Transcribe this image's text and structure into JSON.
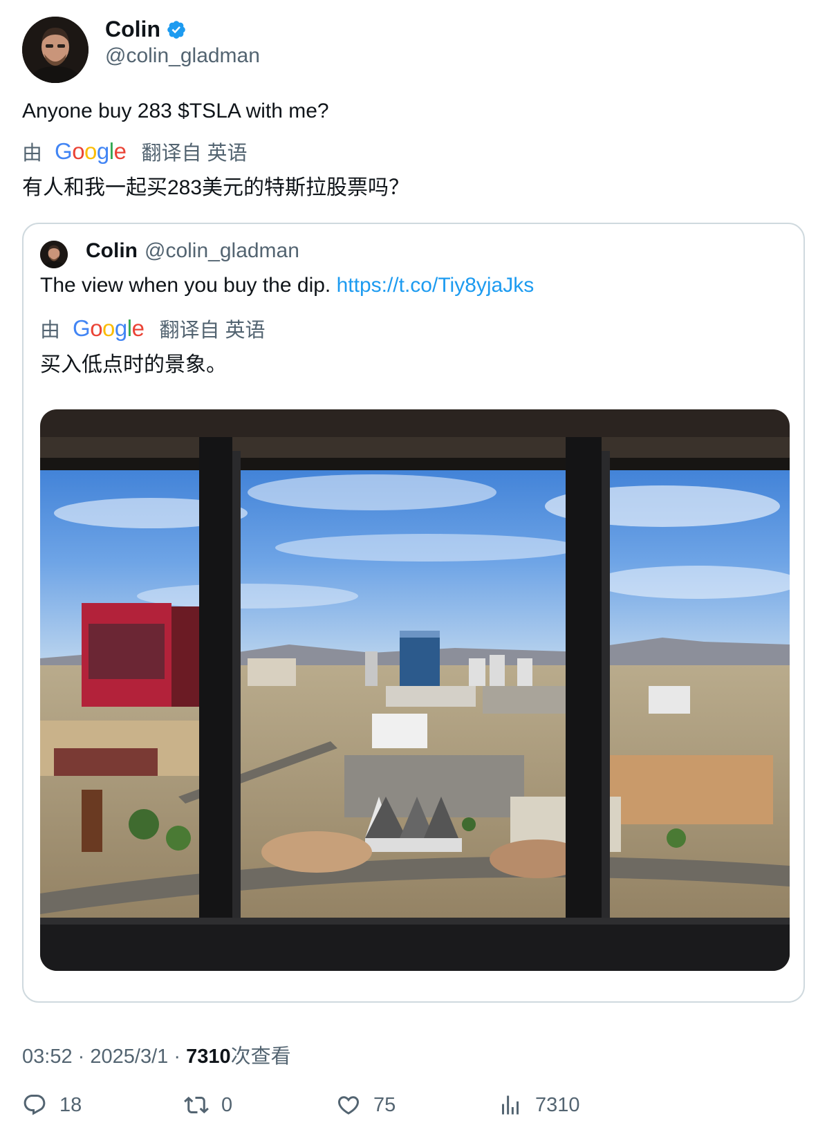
{
  "author": {
    "name": "Colin",
    "handle": "@colin_gladman",
    "verified": true
  },
  "tweet": {
    "text": "Anyone buy 283 $TSLA with me?",
    "translation_prefix": "由",
    "translation_provider": "Google",
    "translation_suffix": "翻译自 英语",
    "translation_text": "有人和我一起买283美元的特斯拉股票吗？"
  },
  "quote": {
    "name": "Colin",
    "handle": "@colin_gladman",
    "text": "The view when you buy the dip.",
    "link": "https://t.co/Tiy8yjaJks",
    "translation_prefix": "由",
    "translation_provider": "Google",
    "translation_suffix": "翻译自 英语",
    "translation_text": "买入低点时的景象。"
  },
  "meta": {
    "time": "03:52",
    "date": "2025/3/1",
    "views": "7310",
    "views_label": "次查看",
    "separator": "·"
  },
  "actions": {
    "replies": "18",
    "retweets": "0",
    "likes": "75",
    "views": "7310"
  },
  "colors": {
    "link": "#1d9bf0",
    "secondary_text": "#536471",
    "verified": "#1d9bf0",
    "border": "#cfd9de"
  },
  "icons": [
    "verified-badge-icon",
    "reply-icon",
    "retweet-icon",
    "like-icon",
    "views-icon"
  ]
}
